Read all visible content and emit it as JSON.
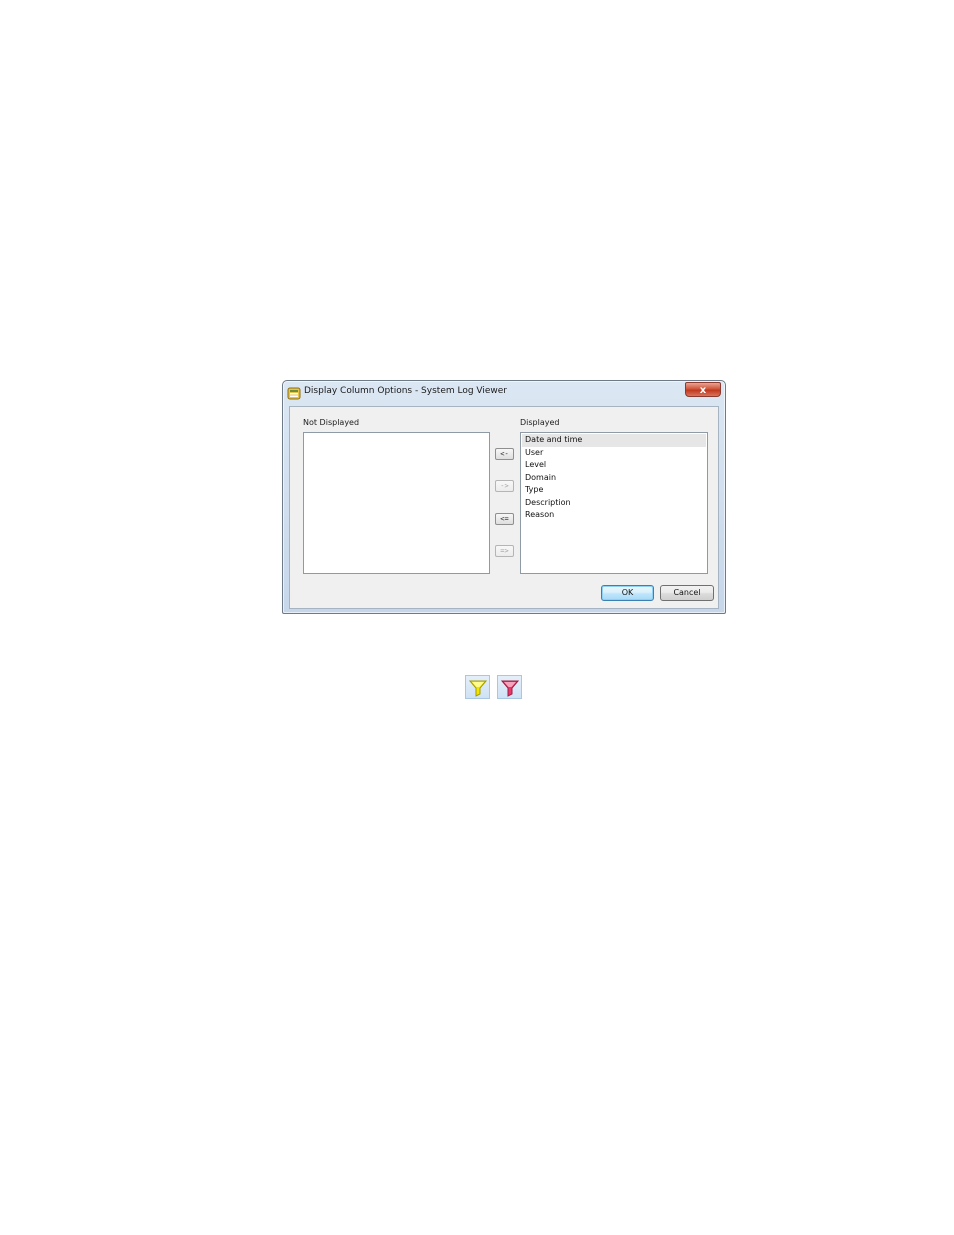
{
  "dialog": {
    "title": "Display Column Options - System Log Viewer",
    "close_label": "x",
    "app_icon": "system-log-viewer-icon",
    "not_displayed": {
      "label": "Not Displayed",
      "items": []
    },
    "displayed": {
      "label": "Displayed",
      "items": [
        "Date and time",
        "User",
        "Level",
        "Domain",
        "Type",
        "Description",
        "Reason"
      ],
      "selected_index": 0
    },
    "move_buttons": {
      "move_left": "<-",
      "move_right": "->",
      "move_all_left": "<=",
      "move_all_right": "=>"
    },
    "ok_label": "OK",
    "cancel_label": "Cancel"
  },
  "icons": {
    "filter_apply": "funnel-yellow-icon",
    "filter_clear": "funnel-red-icon"
  },
  "colors": {
    "title_bar": "#c7d7ea",
    "close_button": "#c0391f",
    "ok_button_border": "#3c7fb1",
    "filter_apply": "#f2e600",
    "filter_clear": "#e8386a"
  }
}
